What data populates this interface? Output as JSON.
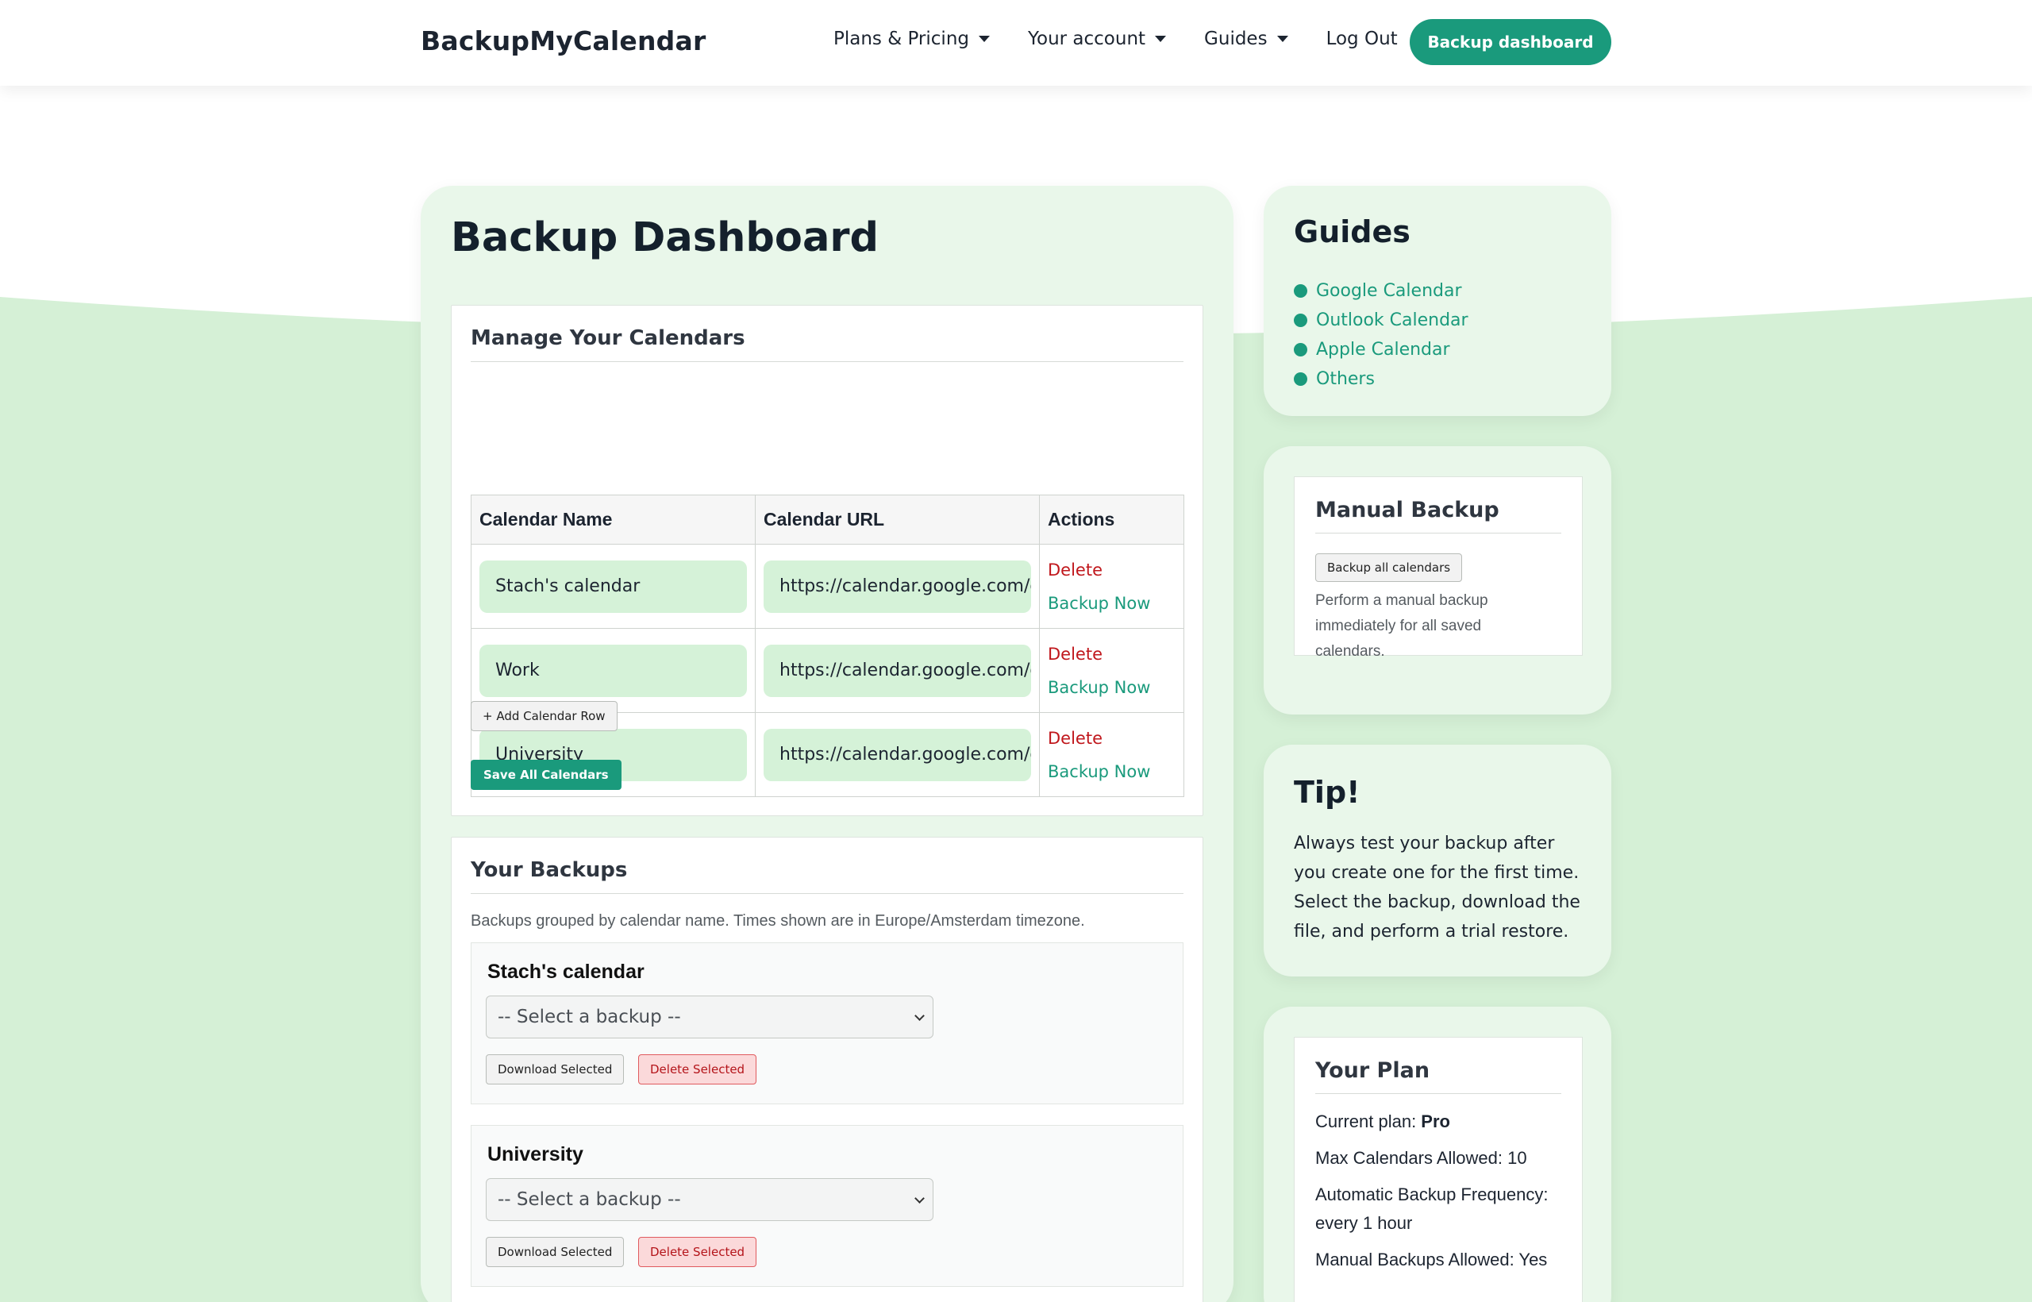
{
  "header": {
    "brand": "BackupMyCalendar",
    "nav": [
      {
        "label": "Plans & Pricing",
        "has_caret": true
      },
      {
        "label": "Your account",
        "has_caret": true
      },
      {
        "label": "Guides",
        "has_caret": true
      },
      {
        "label": "Log Out",
        "has_caret": false
      }
    ],
    "cta_label": "Backup dashboard"
  },
  "main": {
    "title": "Backup Dashboard",
    "manage": {
      "title": "Manage Your Calendars",
      "columns": [
        "Calendar Name",
        "Calendar URL",
        "Actions"
      ],
      "rows": [
        {
          "name": "Stach's calendar",
          "url": "https://calendar.google.com/ca",
          "delete": "Delete",
          "backup": "Backup Now"
        },
        {
          "name": "Work",
          "url": "https://calendar.google.com/ca",
          "delete": "Delete",
          "backup": "Backup Now"
        },
        {
          "name": "University",
          "url": "https://calendar.google.com/ca",
          "delete": "Delete",
          "backup": "Backup Now"
        }
      ],
      "add_row_label": "+ Add Calendar Row",
      "save_label": "Save All Calendars"
    },
    "backups": {
      "title": "Your Backups",
      "note": "Backups grouped by calendar name. Times shown are in Europe/Amsterdam timezone.",
      "groups": [
        {
          "name": "Stach's calendar",
          "select_placeholder": "-- Select a backup --",
          "download_label": "Download Selected",
          "delete_label": "Delete Selected"
        },
        {
          "name": "University",
          "select_placeholder": "-- Select a backup --",
          "download_label": "Download Selected",
          "delete_label": "Delete Selected"
        }
      ]
    }
  },
  "sidebar": {
    "guides": {
      "title": "Guides",
      "items": [
        "Google Calendar",
        "Outlook Calendar",
        "Apple Calendar",
        "Others"
      ]
    },
    "manual": {
      "title": "Manual Backup",
      "button_label": "Backup all calendars",
      "description": "Perform a manual backup immediately for all saved calendars."
    },
    "tip": {
      "title": "Tip!",
      "text": "Always test your backup after you create one for the first time. Select the backup, download the file, and perform a trial restore."
    },
    "plan": {
      "title": "Your Plan",
      "current_label": "Current plan: ",
      "current_value": "Pro",
      "max_calendars": "Max Calendars Allowed: 10",
      "frequency": "Automatic Backup Frequency: every 1 hour",
      "manual_allowed": "Manual Backups Allowed: Yes"
    }
  },
  "colors": {
    "accent": "#1a9a7c",
    "danger": "#c0171c",
    "card_bg": "#e9f7ea",
    "wave_bg": "#d5f0d6"
  }
}
